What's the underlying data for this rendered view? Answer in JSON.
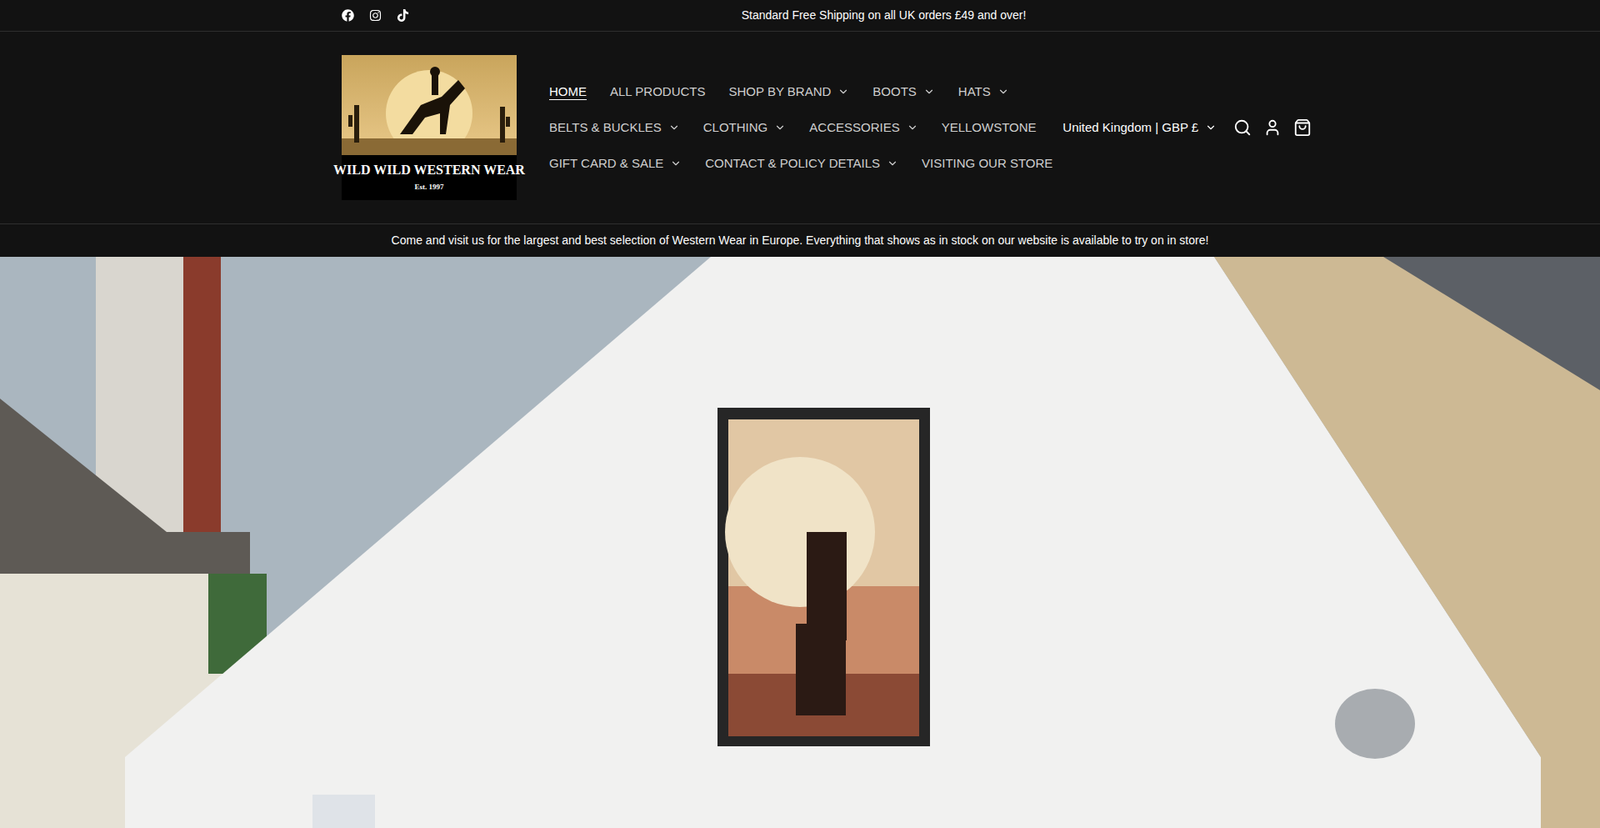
{
  "announcement": {
    "text": "Standard Free Shipping on all UK orders £49 and over!"
  },
  "logo": {
    "name": "WILD WILD WESTERN WEAR",
    "established": "Est. 1997"
  },
  "nav": {
    "rows": [
      [
        {
          "label": "HOME",
          "selected": true,
          "dropdown": false
        },
        {
          "label": "ALL PRODUCTS",
          "selected": false,
          "dropdown": false
        },
        {
          "label": "SHOP BY BRAND",
          "selected": false,
          "dropdown": true
        },
        {
          "label": "BOOTS",
          "selected": false,
          "dropdown": true
        },
        {
          "label": "HATS",
          "selected": false,
          "dropdown": true
        }
      ],
      [
        {
          "label": "BELTS & BUCKLES",
          "selected": false,
          "dropdown": true
        },
        {
          "label": "CLOTHING",
          "selected": false,
          "dropdown": true
        },
        {
          "label": "ACCESSORIES",
          "selected": false,
          "dropdown": true
        },
        {
          "label": "YELLOWSTONE",
          "selected": false,
          "dropdown": false
        }
      ],
      [
        {
          "label": "GIFT CARD & SALE",
          "selected": false,
          "dropdown": true
        },
        {
          "label": "CONTACT & POLICY DETAILS",
          "selected": false,
          "dropdown": true
        },
        {
          "label": "VISITING OUR STORE",
          "selected": false,
          "dropdown": false
        }
      ]
    ]
  },
  "localization": {
    "label": "United Kingdom | GBP £"
  },
  "store_banner": {
    "text": "Come and visit us for the largest and best selection of Western Wear in Europe. Everything that shows as in stock on our website is available to try on in store!"
  }
}
